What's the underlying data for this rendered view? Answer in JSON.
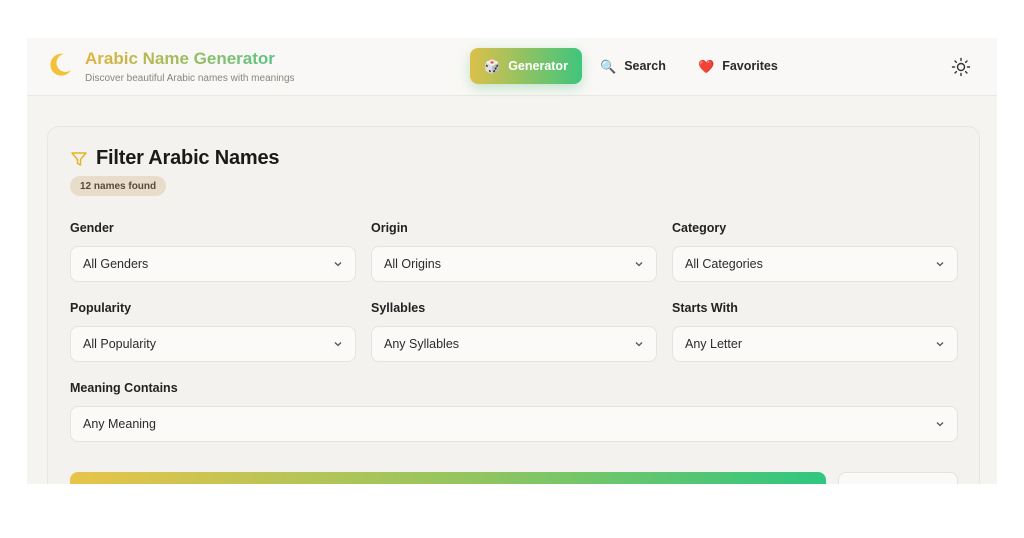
{
  "header": {
    "title": "Arabic Name Generator",
    "subtitle": "Discover beautiful Arabic names with meanings",
    "logo_icon": "crescent-moon-icon",
    "nav": [
      {
        "label": "Generator",
        "icon": "🎲",
        "active": true
      },
      {
        "label": "Search",
        "icon": "🔍",
        "active": false
      },
      {
        "label": "Favorites",
        "icon": "❤️",
        "active": false
      }
    ],
    "theme_toggle_icon": "sun-icon"
  },
  "filter": {
    "title": "Filter Arabic Names",
    "count_badge": "12 names found",
    "fields": [
      {
        "label": "Gender",
        "value": "All Genders"
      },
      {
        "label": "Origin",
        "value": "All Origins"
      },
      {
        "label": "Category",
        "value": "All Categories"
      },
      {
        "label": "Popularity",
        "value": "All Popularity"
      },
      {
        "label": "Syllables",
        "value": "Any Syllables"
      },
      {
        "label": "Starts With",
        "value": "Any Letter"
      },
      {
        "label": "Meaning Contains",
        "value": "Any Meaning"
      }
    ]
  },
  "colors": {
    "accent_start": "#e3b33c",
    "accent_end": "#3fc57d",
    "background": "#f6f4f1"
  }
}
